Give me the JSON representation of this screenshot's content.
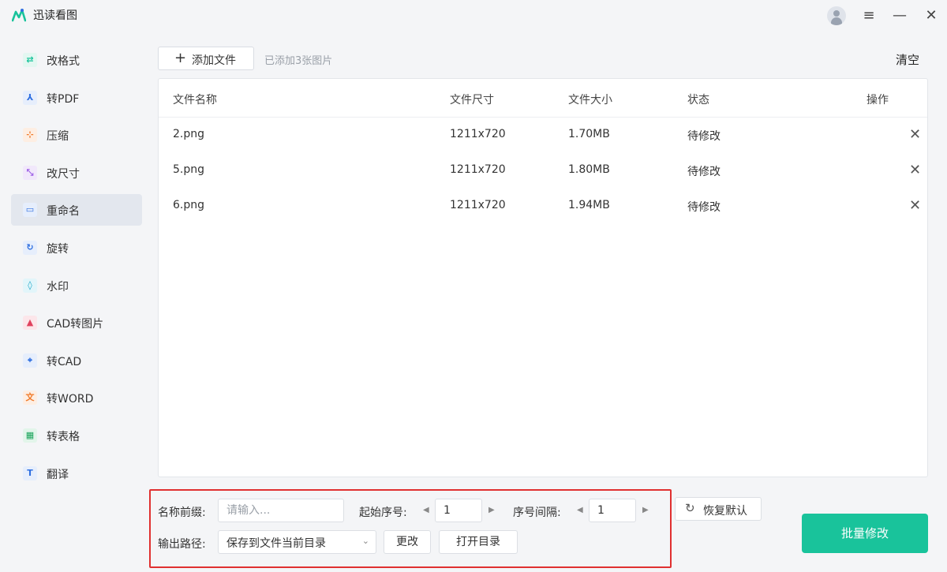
{
  "app": {
    "title": "迅读看图",
    "brand_color": "#19c39b"
  },
  "window_controls": {
    "menu_icon": "≡",
    "minimize_icon": "—",
    "close_icon": "✕"
  },
  "sidebar": {
    "active_index": 4,
    "items": [
      {
        "label": "改格式",
        "icon": "⇄",
        "icon_name": "format-convert-icon",
        "color": "#19c39b",
        "bg": "#e3f7f1"
      },
      {
        "label": "转PDF",
        "icon": "⅄",
        "icon_name": "pdf-icon",
        "color": "#2f6fe0",
        "bg": "#e6eefc"
      },
      {
        "label": "压缩",
        "icon": "⊹",
        "icon_name": "compress-icon",
        "color": "#f07a2a",
        "bg": "#fdeee3"
      },
      {
        "label": "改尺寸",
        "icon": "⤡",
        "icon_name": "resize-icon",
        "color": "#9b5de5",
        "bg": "#f1e8fb"
      },
      {
        "label": "重命名",
        "icon": "▭",
        "icon_name": "rename-icon",
        "color": "#2f6fe0",
        "bg": "#e6eefc"
      },
      {
        "label": "旋转",
        "icon": "↻",
        "icon_name": "rotate-icon",
        "color": "#2f6fe0",
        "bg": "#e6eefc"
      },
      {
        "label": "水印",
        "icon": "◊",
        "icon_name": "watermark-icon",
        "color": "#1aa6c9",
        "bg": "#e2f5fa"
      },
      {
        "label": "CAD转图片",
        "icon": "▲",
        "icon_name": "cad-to-image-icon",
        "color": "#e0425e",
        "bg": "#fce6ea"
      },
      {
        "label": "转CAD",
        "icon": "⌖",
        "icon_name": "to-cad-icon",
        "color": "#2f6fe0",
        "bg": "#e6eefc"
      },
      {
        "label": "转WORD",
        "icon": "文",
        "icon_name": "translate-word-icon",
        "color": "#f07a2a",
        "bg": "#fdeee3"
      },
      {
        "label": "转表格",
        "icon": "▦",
        "icon_name": "table-icon",
        "color": "#19a35a",
        "bg": "#e2f5ea"
      },
      {
        "label": "翻译",
        "icon": "T",
        "icon_name": "translate-icon",
        "color": "#2f6fe0",
        "bg": "#e6eefc"
      }
    ]
  },
  "toolbar": {
    "add_icon": "+",
    "add_label": "添加文件",
    "added_count": "已添加3张图片",
    "clear_label": "清空"
  },
  "table": {
    "headers": {
      "name": "文件名称",
      "dims": "文件尺寸",
      "size": "文件大小",
      "status": "状态",
      "action": "操作"
    },
    "delete_icon": "✕",
    "rows": [
      {
        "name": "2.png",
        "dims": "1211x720",
        "size": "1.70MB",
        "status": "待修改"
      },
      {
        "name": "5.png",
        "dims": "1211x720",
        "size": "1.80MB",
        "status": "待修改"
      },
      {
        "name": "6.png",
        "dims": "1211x720",
        "size": "1.94MB",
        "status": "待修改"
      }
    ]
  },
  "settings": {
    "prefix_label": "名称前缀:",
    "prefix_placeholder": "请输入...",
    "start_label": "起始序号:",
    "start_value": "1",
    "interval_label": "序号间隔:",
    "interval_value": "1",
    "output_label": "输出路径:",
    "output_value": "保存到文件当前目录",
    "change_label": "更改",
    "open_label": "打开目录",
    "arrow_left": "◀",
    "arrow_right": "▶",
    "chevron": "⌄",
    "restore_icon": "↻",
    "restore_label": "恢复默认"
  },
  "actions": {
    "batch_label": "批量修改"
  }
}
